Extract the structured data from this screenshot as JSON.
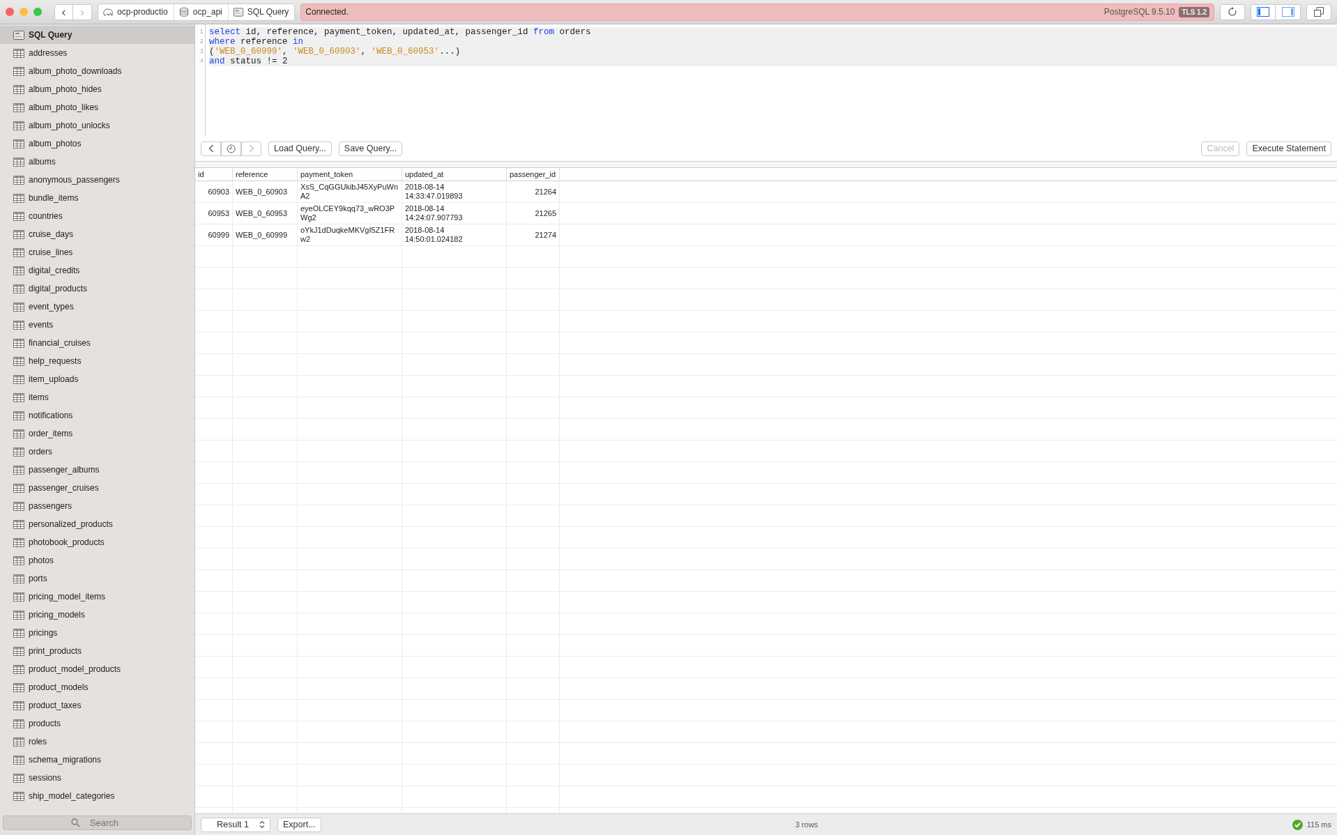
{
  "toolbar": {
    "nav": [
      {
        "label": "‹",
        "disabled": false
      },
      {
        "label": "›",
        "disabled": true
      }
    ],
    "breadcrumb": [
      {
        "label": "ocp-productio",
        "kind": "server"
      },
      {
        "label": "ocp_api",
        "kind": "database"
      },
      {
        "label": "SQL Query",
        "kind": "query"
      }
    ],
    "status": {
      "message": "Connected.",
      "server": "PostgreSQL 9.5.10",
      "badge": "TLS 1.2"
    },
    "panel_toggles": [
      {
        "kind": "left",
        "selected": true
      },
      {
        "kind": "right",
        "selected": false
      }
    ]
  },
  "sidebar": {
    "items": [
      {
        "label": "SQL Query",
        "kind": "query",
        "selected": true
      },
      {
        "label": "addresses",
        "kind": "table",
        "selected": false
      },
      {
        "label": "album_photo_downloads",
        "kind": "table",
        "selected": false
      },
      {
        "label": "album_photo_hides",
        "kind": "table",
        "selected": false
      },
      {
        "label": "album_photo_likes",
        "kind": "table",
        "selected": false
      },
      {
        "label": "album_photo_unlocks",
        "kind": "table",
        "selected": false
      },
      {
        "label": "album_photos",
        "kind": "table",
        "selected": false
      },
      {
        "label": "albums",
        "kind": "table",
        "selected": false
      },
      {
        "label": "anonymous_passengers",
        "kind": "table",
        "selected": false
      },
      {
        "label": "bundle_items",
        "kind": "table",
        "selected": false
      },
      {
        "label": "countries",
        "kind": "table",
        "selected": false
      },
      {
        "label": "cruise_days",
        "kind": "table",
        "selected": false
      },
      {
        "label": "cruise_lines",
        "kind": "table",
        "selected": false
      },
      {
        "label": "digital_credits",
        "kind": "table",
        "selected": false
      },
      {
        "label": "digital_products",
        "kind": "table",
        "selected": false
      },
      {
        "label": "event_types",
        "kind": "table",
        "selected": false
      },
      {
        "label": "events",
        "kind": "table",
        "selected": false
      },
      {
        "label": "financial_cruises",
        "kind": "table",
        "selected": false
      },
      {
        "label": "help_requests",
        "kind": "table",
        "selected": false
      },
      {
        "label": "item_uploads",
        "kind": "table",
        "selected": false
      },
      {
        "label": "items",
        "kind": "table",
        "selected": false
      },
      {
        "label": "notifications",
        "kind": "table",
        "selected": false
      },
      {
        "label": "order_items",
        "kind": "table",
        "selected": false
      },
      {
        "label": "orders",
        "kind": "table",
        "selected": false
      },
      {
        "label": "passenger_albums",
        "kind": "table",
        "selected": false
      },
      {
        "label": "passenger_cruises",
        "kind": "table",
        "selected": false
      },
      {
        "label": "passengers",
        "kind": "table",
        "selected": false
      },
      {
        "label": "personalized_products",
        "kind": "table",
        "selected": false
      },
      {
        "label": "photobook_products",
        "kind": "table",
        "selected": false
      },
      {
        "label": "photos",
        "kind": "table",
        "selected": false
      },
      {
        "label": "ports",
        "kind": "table",
        "selected": false
      },
      {
        "label": "pricing_model_items",
        "kind": "table",
        "selected": false
      },
      {
        "label": "pricing_models",
        "kind": "table",
        "selected": false
      },
      {
        "label": "pricings",
        "kind": "table",
        "selected": false
      },
      {
        "label": "print_products",
        "kind": "table",
        "selected": false
      },
      {
        "label": "product_model_products",
        "kind": "table",
        "selected": false
      },
      {
        "label": "product_models",
        "kind": "table",
        "selected": false
      },
      {
        "label": "product_taxes",
        "kind": "table",
        "selected": false
      },
      {
        "label": "products",
        "kind": "table",
        "selected": false
      },
      {
        "label": "roles",
        "kind": "table",
        "selected": false
      },
      {
        "label": "schema_migrations",
        "kind": "table",
        "selected": false
      },
      {
        "label": "sessions",
        "kind": "table",
        "selected": false
      },
      {
        "label": "ship_model_categories",
        "kind": "table",
        "selected": false
      }
    ],
    "search": {
      "placeholder": "Search"
    }
  },
  "editor": {
    "lines": [
      {
        "number": "1",
        "tokens": [
          {
            "text": "select",
            "kind": "keyword"
          },
          {
            "text": " id, reference, payment_token, updated_at, passenger_id ",
            "kind": "plain"
          },
          {
            "text": "from",
            "kind": "keyword"
          },
          {
            "text": " orders",
            "kind": "plain"
          }
        ]
      },
      {
        "number": "2",
        "tokens": [
          {
            "text": "where",
            "kind": "keyword"
          },
          {
            "text": " reference ",
            "kind": "plain"
          },
          {
            "text": "in",
            "kind": "keyword"
          }
        ]
      },
      {
        "number": "3",
        "tokens": [
          {
            "text": "(",
            "kind": "plain"
          },
          {
            "text": "'WEB_0_60999'",
            "kind": "string"
          },
          {
            "text": ", ",
            "kind": "plain"
          },
          {
            "text": "'WEB_0_60903'",
            "kind": "string"
          },
          {
            "text": ", ",
            "kind": "plain"
          },
          {
            "text": "'WEB_0_60953'",
            "kind": "string"
          },
          {
            "text": "...)",
            "kind": "plain"
          }
        ]
      },
      {
        "number": "4",
        "tokens": [
          {
            "text": "and",
            "kind": "keyword"
          },
          {
            "text": " status != 2",
            "kind": "plain"
          }
        ]
      }
    ]
  },
  "query_bar": {
    "history": [
      {
        "kind": "back",
        "disabled": false
      },
      {
        "kind": "history",
        "disabled": false
      },
      {
        "kind": "forward",
        "disabled": true
      }
    ],
    "buttons": [
      {
        "label": "Load Query...",
        "disabled": false
      },
      {
        "label": "Save Query...",
        "disabled": false
      }
    ],
    "right_buttons": [
      {
        "label": "Cancel",
        "disabled": true
      },
      {
        "label": "Execute Statement",
        "disabled": false
      }
    ]
  },
  "table": {
    "columns": [
      {
        "label": "id",
        "kind": "number"
      },
      {
        "label": "reference",
        "kind": "text"
      },
      {
        "label": "payment_token",
        "kind": "text"
      },
      {
        "label": "updated_at",
        "kind": "text"
      },
      {
        "label": "passenger_id",
        "kind": "number"
      }
    ],
    "rows": [
      [
        "60903",
        "WEB_0_60903",
        "XsS_CqGGUkibJ45XyPuWn\nA2",
        "2018-08-14\n14:33:47.019893",
        "21264"
      ],
      [
        "60953",
        "WEB_0_60953",
        "eyeOLCEY9kqq73_wRO3P\nWg2",
        "2018-08-14\n14:24:07.907793",
        "21265"
      ],
      [
        "60999",
        "WEB_0_60999",
        "oYkJ1dDuqkeMKVgI5Z1FR\nw2",
        "2018-08-14\n14:50:01.024182",
        "21274"
      ]
    ]
  },
  "status_bar": {
    "result": "Result 1",
    "export": "Export...",
    "row_count": "3 rows",
    "time": "115 ms",
    "success": true
  }
}
